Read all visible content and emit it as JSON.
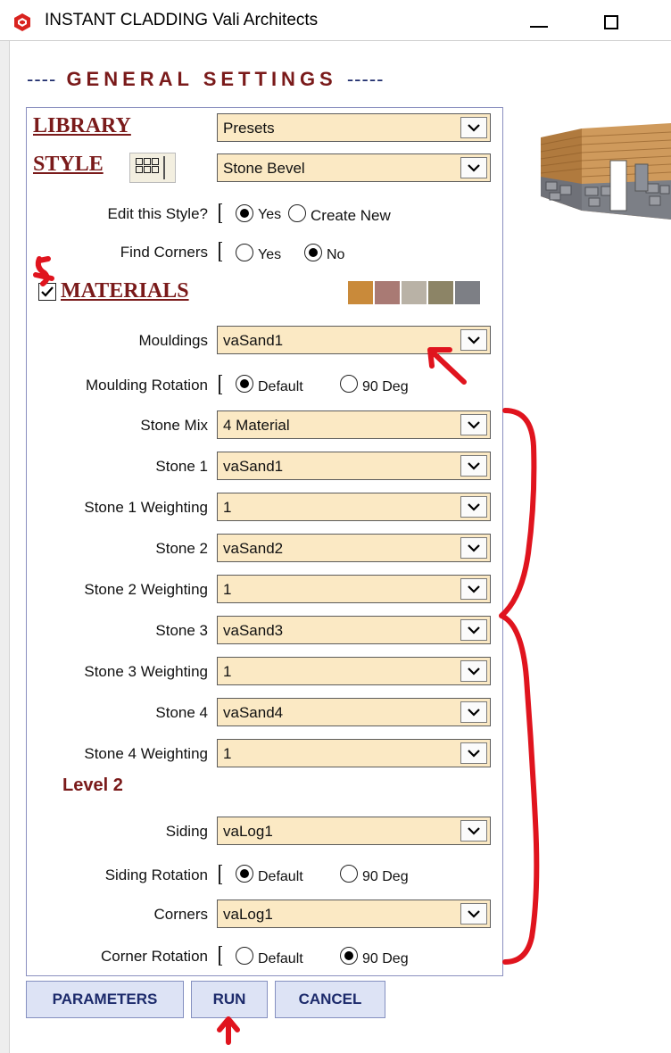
{
  "window": {
    "title": "INSTANT CLADDING  Vali Architects",
    "minimize_icon": "minimize-icon",
    "maximize_icon": "maximize-icon"
  },
  "heading": {
    "left_dashes": "----",
    "text": "GENERAL SETTINGS",
    "right_dashes": "-----"
  },
  "library": {
    "label": "LIBRARY",
    "value": "Presets"
  },
  "style": {
    "label": "STYLE",
    "value": "Stone Bevel",
    "grid_icon": "grid-icon"
  },
  "edit_style": {
    "label": "Edit this Style?",
    "options": [
      "Yes",
      "Create New"
    ],
    "selected": "Yes"
  },
  "find_corners": {
    "label": "Find Corners",
    "options": [
      "Yes",
      "No"
    ],
    "selected": "No"
  },
  "materials": {
    "label": "MATERIALS",
    "checked": true,
    "swatch_colors": [
      "#c98a3a",
      "#a97a74",
      "#b9b2a6",
      "#8c8466",
      "#7d7f85"
    ]
  },
  "mouldings": {
    "label": "Mouldings",
    "value": "vaSand1"
  },
  "moulding_rotation": {
    "label": "Moulding Rotation",
    "options": [
      "Default",
      "90 Deg"
    ],
    "selected": "Default"
  },
  "stone_rows": [
    {
      "label": "Stone Mix",
      "value": "4 Material"
    },
    {
      "label": "Stone 1",
      "value": "vaSand1"
    },
    {
      "label": "Stone 1 Weighting",
      "value": "1"
    },
    {
      "label": "Stone 2",
      "value": "vaSand2"
    },
    {
      "label": "Stone 2 Weighting",
      "value": "1"
    },
    {
      "label": "Stone 3",
      "value": "vaSand3"
    },
    {
      "label": "Stone 3 Weighting",
      "value": "1"
    },
    {
      "label": "Stone 4",
      "value": "vaSand4"
    },
    {
      "label": "Stone 4 Weighting",
      "value": "1"
    }
  ],
  "level2": {
    "label": "Level 2"
  },
  "siding": {
    "label": "Siding",
    "value": "vaLog1"
  },
  "siding_rotation": {
    "label": "Siding Rotation",
    "options": [
      "Default",
      "90 Deg"
    ],
    "selected": "Default"
  },
  "corners": {
    "label": "Corners",
    "value": "vaLog1"
  },
  "corner_rotation": {
    "label": "Corner Rotation",
    "options": [
      "Default",
      "90 Deg"
    ],
    "selected": "90 Deg"
  },
  "buttons": {
    "parameters": "PARAMETERS",
    "run": "RUN",
    "cancel": "CANCEL"
  },
  "colors": {
    "heading": "#7a1a1a",
    "field_bg": "#fbe9c4",
    "button_bg": "#dde3f5",
    "annotation": "#e0141e"
  }
}
